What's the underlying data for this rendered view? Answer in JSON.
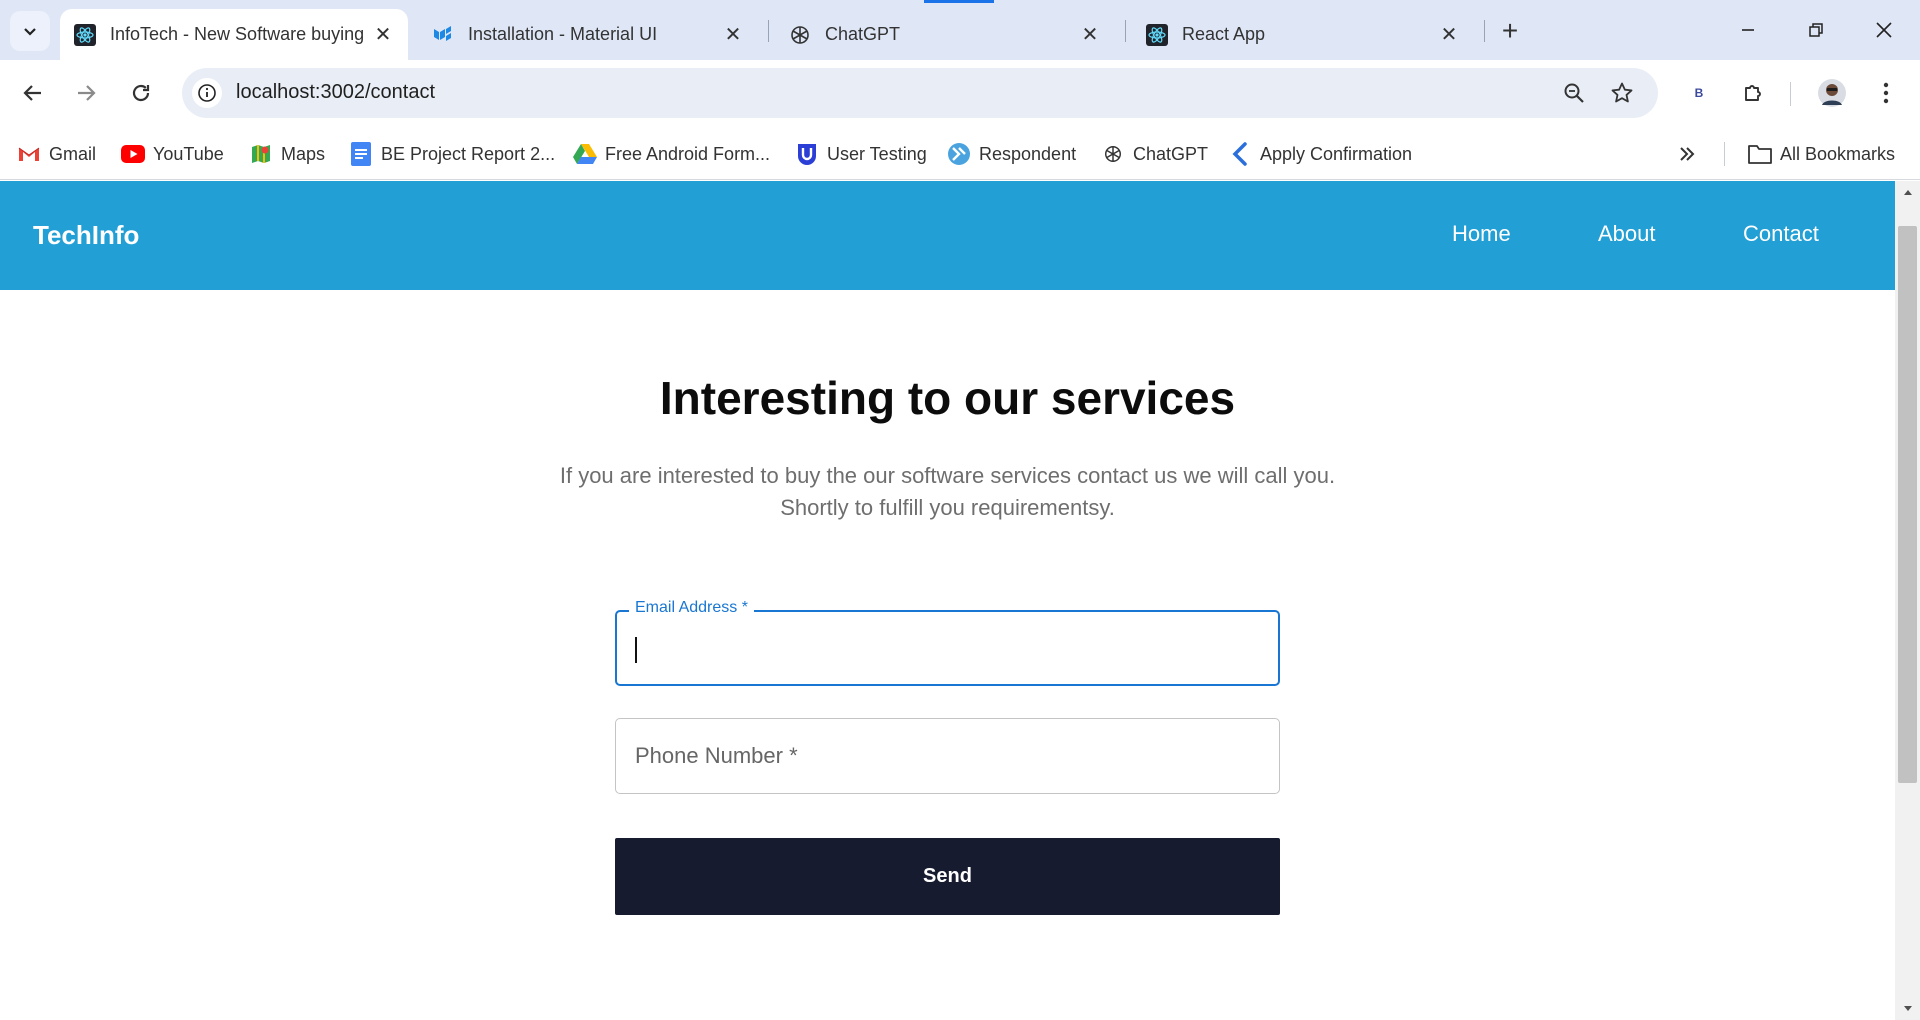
{
  "browser": {
    "tabs": [
      {
        "title": "InfoTech - New Software buying",
        "favicon": "react-icon",
        "active": true
      },
      {
        "title": "Installation - Material UI",
        "favicon": "mui-icon",
        "active": false
      },
      {
        "title": "ChatGPT",
        "favicon": "chatgpt-icon",
        "active": false
      },
      {
        "title": "React App",
        "favicon": "react-icon",
        "active": false
      }
    ],
    "url": "localhost:3002/contact",
    "profile_badge": "B",
    "bookmarks": [
      {
        "label": "Gmail",
        "icon": "gmail-icon"
      },
      {
        "label": "YouTube",
        "icon": "youtube-icon"
      },
      {
        "label": "Maps",
        "icon": "maps-icon"
      },
      {
        "label": "BE Project Report 2...",
        "icon": "docs-icon"
      },
      {
        "label": "Free Android Form...",
        "icon": "drive-icon"
      },
      {
        "label": "User Testing",
        "icon": "usertesting-icon"
      },
      {
        "label": "Respondent",
        "icon": "respondent-icon"
      },
      {
        "label": "ChatGPT",
        "icon": "chatgpt-icon"
      },
      {
        "label": "Apply Confirmation",
        "icon": "apply-icon"
      }
    ],
    "all_bookmarks": "All Bookmarks",
    "accent_color": "#1a73e8"
  },
  "page": {
    "navbar": {
      "brand": "TechInfo",
      "links": [
        "Home",
        "About",
        "Contact"
      ],
      "bg_color": "#229fd5"
    },
    "headline": "Interesting to our services",
    "subtext_line1": "If you are interested to buy the our software services contact us we will call you.",
    "subtext_line2": "Shortly to fulfill you requirementsy.",
    "form": {
      "email_label": "Email Address *",
      "phone_label": "Phone Number *",
      "send_label": "Send",
      "focus_color": "#1976d2",
      "button_color": "#161b2f"
    }
  }
}
